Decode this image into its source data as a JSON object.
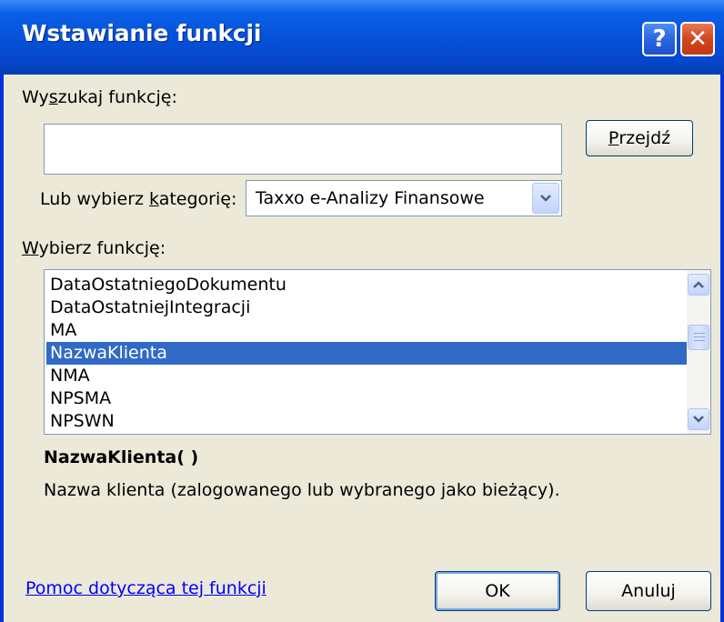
{
  "dialog": {
    "title": "Wstawianie funkcji",
    "help_button": "?",
    "close_button": "✕"
  },
  "search": {
    "label_prefix": "Wy",
    "label_u": "s",
    "label_suffix": "zukaj funkcję:",
    "value": "",
    "go_prefix": "",
    "go_u": "P",
    "go_suffix": "rzejdź"
  },
  "category": {
    "label_prefix": "Lub wybierz ",
    "label_u": "k",
    "label_suffix": "ategorię:",
    "selected": "Taxxo e-Analizy Finansowe"
  },
  "functions": {
    "label_u": "W",
    "label_suffix": "ybierz funkcję:",
    "items": [
      "DataOstatniegoDokumentu",
      "DataOstatniejIntegracji",
      "MA",
      "NazwaKlienta",
      "NMA",
      "NPSMA",
      "NPSWN"
    ],
    "selected_index": 3
  },
  "description": {
    "signature": "NazwaKlienta( )",
    "text": "Nazwa klienta (zalogowanego lub wybranego jako bieżący)."
  },
  "footer": {
    "help_link": "Pomoc dotycząca tej funkcji",
    "ok": "OK",
    "cancel": "Anuluj"
  },
  "colors": {
    "title_bar": "#0550d8",
    "dialog_bg": "#ece9d8",
    "selection": "#316ac5",
    "link": "#0000ff"
  }
}
